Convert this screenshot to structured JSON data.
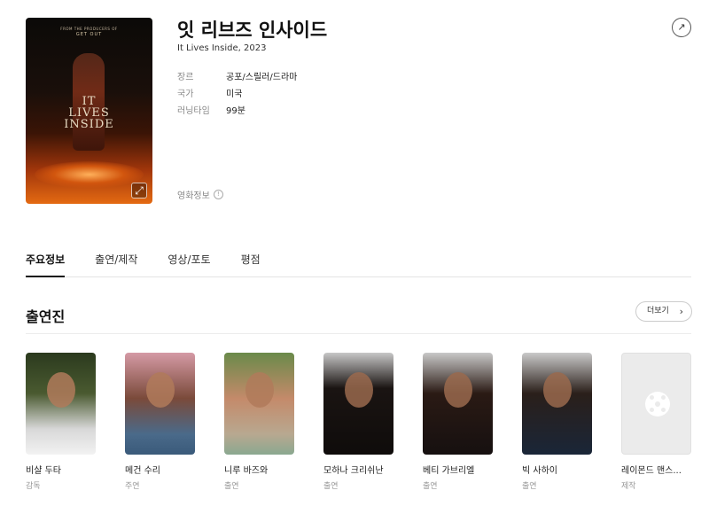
{
  "movie": {
    "title": "잇 리브즈 인사이드",
    "subtitle": "It Lives Inside, 2023",
    "poster": {
      "top_text": "FROM THE PRODUCERS OF",
      "sub_text": "GET OUT",
      "title_art": [
        "IT",
        "LIVES",
        "INSIDE"
      ]
    }
  },
  "meta": [
    {
      "label": "장르",
      "value": "공포/스릴러/드라마"
    },
    {
      "label": "국가",
      "value": "미국"
    },
    {
      "label": "러닝타임",
      "value": "99분"
    }
  ],
  "info_link": {
    "label": "영화정보",
    "icon": "info-icon"
  },
  "tabs": [
    {
      "label": "주요정보",
      "active": true
    },
    {
      "label": "출연/제작",
      "active": false
    },
    {
      "label": "영상/포토",
      "active": false
    },
    {
      "label": "평점",
      "active": false
    }
  ],
  "cast_section": {
    "heading": "출연진",
    "more_label": "더보기"
  },
  "cast": [
    {
      "name": "비샬 두타",
      "role": "감독"
    },
    {
      "name": "메건 수리",
      "role": "주연"
    },
    {
      "name": "니루 바즈와",
      "role": "출연"
    },
    {
      "name": "모하나 크리쉬난",
      "role": "출연"
    },
    {
      "name": "베티 가브리엘",
      "role": "출연"
    },
    {
      "name": "빅 사하이",
      "role": "출연"
    },
    {
      "name": "레이몬드 맨스...",
      "role": "제작"
    }
  ],
  "colors": {
    "accent": "#111111",
    "muted": "#888888"
  }
}
